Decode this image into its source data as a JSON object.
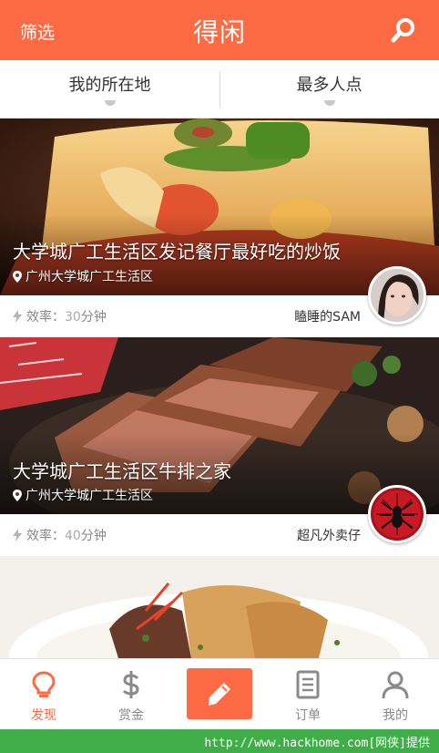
{
  "header": {
    "filter_label": "筛选",
    "title": "得闲",
    "search_icon": "search-icon",
    "bg_color": "#fd6a43"
  },
  "tabs": [
    {
      "label": "我的所在地"
    },
    {
      "label": "最多人点"
    }
  ],
  "cards": [
    {
      "name": "大学城广工生活区发记餐厅最好吃的炒饭",
      "location": "广州大学城广工生活区",
      "eff_label": "效率：",
      "eff_value": "30",
      "eff_unit": "分钟",
      "author": "瞌睡的SAM"
    },
    {
      "name": "大学城广工生活区牛排之家",
      "location": "广州大学城广工生活区",
      "eff_label": "效率：",
      "eff_value": "40",
      "eff_unit": "分钟",
      "author": "超凡外卖仔"
    }
  ],
  "tabbar": {
    "items": [
      {
        "label": "发现",
        "icon": "lightbulb-icon",
        "active": true
      },
      {
        "label": "赏金",
        "icon": "dollar-icon",
        "active": false
      },
      {
        "label": "订单",
        "icon": "document-icon",
        "active": false
      },
      {
        "label": "我的",
        "icon": "user-icon",
        "active": false
      }
    ],
    "compose_icon": "pencil-icon",
    "accent": "#fd6a43"
  },
  "watermark": {
    "text": "http://www.hackhome.com[网侠]提供"
  }
}
